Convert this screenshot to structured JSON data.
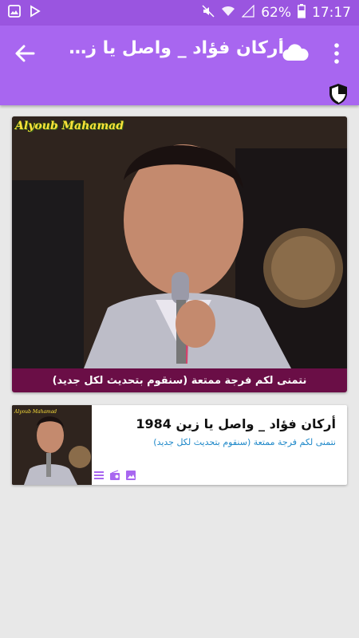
{
  "status_bar": {
    "battery_percent": "62%",
    "time": "17:17"
  },
  "app_bar": {
    "title": "أركان فؤاد _ واصل يا زي...",
    "icons": [
      "arrow-back-icon",
      "cloud-icon",
      "more-vert-icon",
      "shield-icon"
    ],
    "color": "#a866f0"
  },
  "player": {
    "watermark": "Alyoub Mahamad",
    "caption": "نتمنى لكم فرجة ممتعة (سنقوم بتحديث لكل جديد)",
    "caption_color": "#6a0e46"
  },
  "items": [
    {
      "title": "أركان فؤاد _ واصل يا زين 1984",
      "subtitle": "نتمنى لكم فرجة ممتعة (سنقوم بتحديث لكل جديد)",
      "icons": [
        "list-icon",
        "radio-icon",
        "image-icon"
      ],
      "thumb_watermark": "Alyoub Mahamad"
    }
  ]
}
